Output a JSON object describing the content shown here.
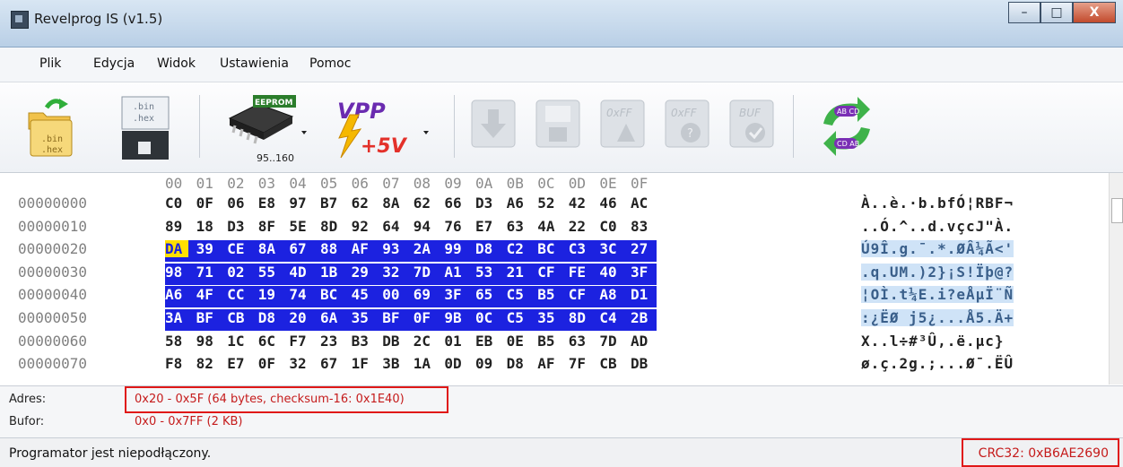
{
  "window": {
    "title": "Revelprog IS (v1.5)",
    "minimize": "–",
    "maximize": "□",
    "close": "X"
  },
  "menu": [
    "Plik",
    "Edycja",
    "Widok",
    "Ustawienia",
    "Pomoc"
  ],
  "toolbar": {
    "open_label_1": ".bin",
    "open_label_2": ".hex",
    "save_label_1": ".bin",
    "save_label_2": ".hex",
    "chip_label": "EEPROM",
    "chip_name": "95..160",
    "vpp_label": "VPP",
    "voltage_label": "+5V",
    "erase_label": "0xFF",
    "blank_label": "0xFF",
    "buf_label": "BUF",
    "swap_top": "AB CD",
    "swap_bottom": "CD AB"
  },
  "hex": {
    "header": [
      "00",
      "01",
      "02",
      "03",
      "04",
      "05",
      "06",
      "07",
      "08",
      "09",
      "0A",
      "0B",
      "0C",
      "0D",
      "0E",
      "0F"
    ],
    "rows": [
      {
        "addr": "00000000",
        "bytes": [
          "C0",
          "0F",
          "06",
          "E8",
          "97",
          "B7",
          "62",
          "8A",
          "62",
          "66",
          "D3",
          "A6",
          "52",
          "42",
          "46",
          "AC"
        ],
        "ascii": "À..è.·b.bfÓ¦RBF¬"
      },
      {
        "addr": "00000010",
        "bytes": [
          "89",
          "18",
          "D3",
          "8F",
          "5E",
          "8D",
          "92",
          "64",
          "94",
          "76",
          "E7",
          "63",
          "4A",
          "22",
          "C0",
          "83"
        ],
        "ascii": "..Ó.^..d.vçcJ\"À."
      },
      {
        "addr": "00000020",
        "bytes": [
          "DA",
          "39",
          "CE",
          "8A",
          "67",
          "88",
          "AF",
          "93",
          "2A",
          "99",
          "D8",
          "C2",
          "BC",
          "C3",
          "3C",
          "27"
        ],
        "ascii": "Ú9Î.g.¯.*.ØÂ¼Ã<'"
      },
      {
        "addr": "00000030",
        "bytes": [
          "98",
          "71",
          "02",
          "55",
          "4D",
          "1B",
          "29",
          "32",
          "7D",
          "A1",
          "53",
          "21",
          "CF",
          "FE",
          "40",
          "3F"
        ],
        "ascii": ".q.UM.)2}¡S!Ïþ@?"
      },
      {
        "addr": "00000040",
        "bytes": [
          "A6",
          "4F",
          "CC",
          "19",
          "74",
          "BC",
          "45",
          "00",
          "69",
          "3F",
          "65",
          "C5",
          "B5",
          "CF",
          "A8",
          "D1"
        ],
        "ascii": "¦OÌ.t¼E.i?eÅµÏ¨Ñ"
      },
      {
        "addr": "00000050",
        "bytes": [
          "3A",
          "BF",
          "CB",
          "D8",
          "20",
          "6A",
          "35",
          "BF",
          "0F",
          "9B",
          "0C",
          "C5",
          "35",
          "8D",
          "C4",
          "2B"
        ],
        "ascii": ":¿ËØ j5¿...Å5.Ä+"
      },
      {
        "addr": "00000060",
        "bytes": [
          "58",
          "98",
          "1C",
          "6C",
          "F7",
          "23",
          "B3",
          "DB",
          "2C",
          "01",
          "EB",
          "0E",
          "B5",
          "63",
          "7D",
          "AD"
        ],
        "ascii": "X..l÷#³Û,.ë.µc}"
      },
      {
        "addr": "00000070",
        "bytes": [
          "F8",
          "82",
          "E7",
          "0F",
          "32",
          "67",
          "1F",
          "3B",
          "1A",
          "0D",
          "09",
          "D8",
          "AF",
          "7F",
          "CB",
          "DB"
        ],
        "ascii": "ø.ç.2g.;...Ø¯.ËÛ"
      }
    ]
  },
  "info": {
    "adres_label": "Adres:",
    "adres_value": "0x20 - 0x5F (64 bytes, checksum-16: 0x1E40)",
    "bufor_label": "Bufor:",
    "bufor_value": "0x0 - 0x7FF (2 KB)"
  },
  "status": {
    "message": "Programator jest niepodłączony.",
    "crc": "CRC32: 0xB6AE2690"
  },
  "colors": {
    "selection": "#1c22e0",
    "cursor": "#ffe000",
    "highlight_box": "#e01818",
    "ascii_selection": "#cfe3f7"
  }
}
